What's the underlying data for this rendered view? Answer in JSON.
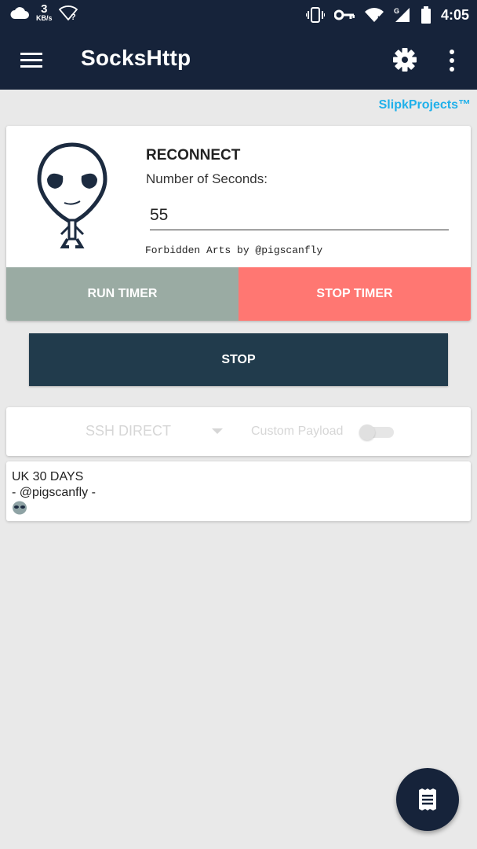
{
  "status_bar": {
    "net_speed_value": "3",
    "net_speed_unit": "KB/s",
    "time": "4:05",
    "icons": [
      "cloud-icon",
      "wifi-unknown-icon",
      "vibrate-icon",
      "vpn-key-icon",
      "wifi-icon",
      "signal-icon",
      "battery-icon"
    ]
  },
  "app_bar": {
    "title": "SocksHttp",
    "icons": [
      "menu-icon",
      "gear-icon",
      "more-vert-icon"
    ]
  },
  "brand": "SlipkProjects™",
  "reconnect": {
    "title": "RECONNECT",
    "seconds_label": "Number of Seconds:",
    "seconds_value": "55",
    "credit": "Forbidden Arts by @pigscanfly",
    "run_timer_label": "RUN TIMER",
    "stop_timer_label": "STOP TIMER"
  },
  "stop_button_label": "STOP",
  "mode": {
    "selected": "SSH DIRECT",
    "custom_payload_label": "Custom Payload",
    "custom_payload_enabled": false
  },
  "config": {
    "line1": "UK 30 DAYS",
    "line2": "- @pigscanfly -",
    "emoji": "alien-face-icon"
  },
  "fab": {
    "icon": "receipt-log-icon"
  },
  "colors": {
    "primary_dark": "#16233a",
    "brand": "#1fb0ea",
    "run_timer": "#9aaba3",
    "stop_timer": "#ff7772",
    "stop": "#213b4c"
  }
}
